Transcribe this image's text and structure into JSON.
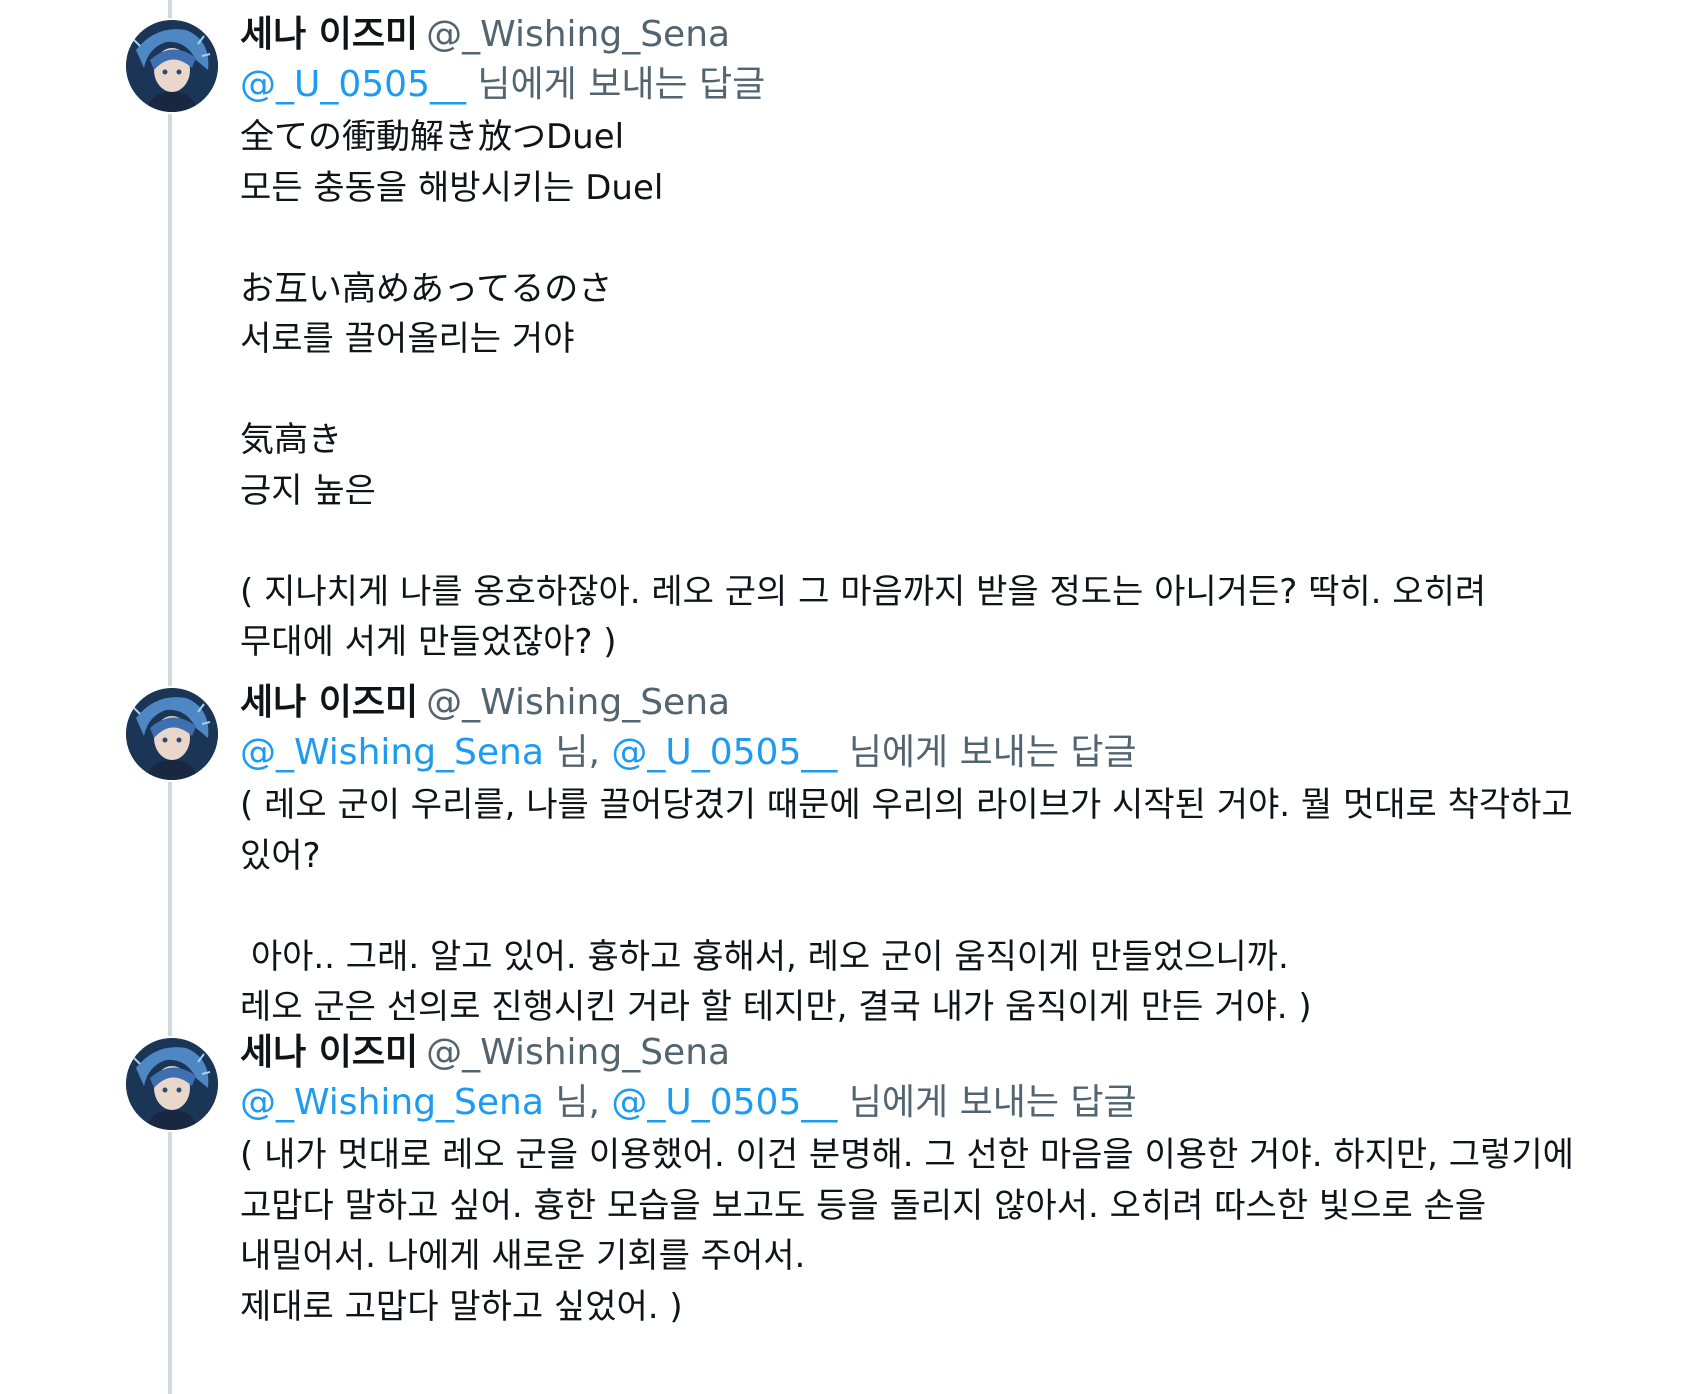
{
  "tweets": [
    {
      "display_name": "세나 이즈미",
      "handle": "@_Wishing_Sena",
      "reply_mentions": [
        "@_U_0505__"
      ],
      "reply_separator": "",
      "reply_suffix": "님에게 보내는 답글",
      "text": "全ての衝動解き放つDuel\n모든 충동을 해방시키는 Duel\n\nお互い高めあってるのさ\n서로를 끌어올리는 거야\n\n気高き\n긍지 높은\n\n( 지나치게 나를 옹호하잖아. 레오 군의 그 마음까지 받을 정도는 아니거든? 딱히. 오히려 무대에 서게 만들었잖아? )"
    },
    {
      "display_name": "세나 이즈미",
      "handle": "@_Wishing_Sena",
      "reply_mentions": [
        "@_Wishing_Sena",
        "@_U_0505__"
      ],
      "reply_separator": " 님, ",
      "reply_suffix": "님에게 보내는 답글",
      "text": "( 레오 군이 우리를, 나를 끌어당겼기 때문에 우리의 라이브가 시작된 거야. 뭘 멋대로 착각하고 있어?\n\n 아아.. 그래. 알고 있어. 흉하고 흉해서, 레오 군이 움직이게 만들었으니까.\n레오 군은 선의로 진행시킨 거라 할 테지만, 결국 내가 움직이게 만든 거야. )"
    },
    {
      "display_name": "세나 이즈미",
      "handle": "@_Wishing_Sena",
      "reply_mentions": [
        "@_Wishing_Sena",
        "@_U_0505__"
      ],
      "reply_separator": " 님, ",
      "reply_suffix": "님에게 보내는 답글",
      "text": "( 내가 멋대로 레오 군을 이용했어. 이건 분명해. 그 선한 마음을 이용한 거야. 하지만, 그렇기에 고맙다 말하고 싶어. 흉한 모습을 보고도 등을 돌리지 않아서. 오히려 따스한 빛으로 손을 내밀어서. 나에게 새로운 기회를 주어서.\n제대로 고맙다 말하고 싶었어. )"
    }
  ],
  "colors": {
    "text": "#0f1419",
    "secondary": "#536471",
    "mention": "#1d9bf0",
    "thread_line": "#cfd9de"
  },
  "icons": {
    "avatar": "avatar-portrait"
  }
}
